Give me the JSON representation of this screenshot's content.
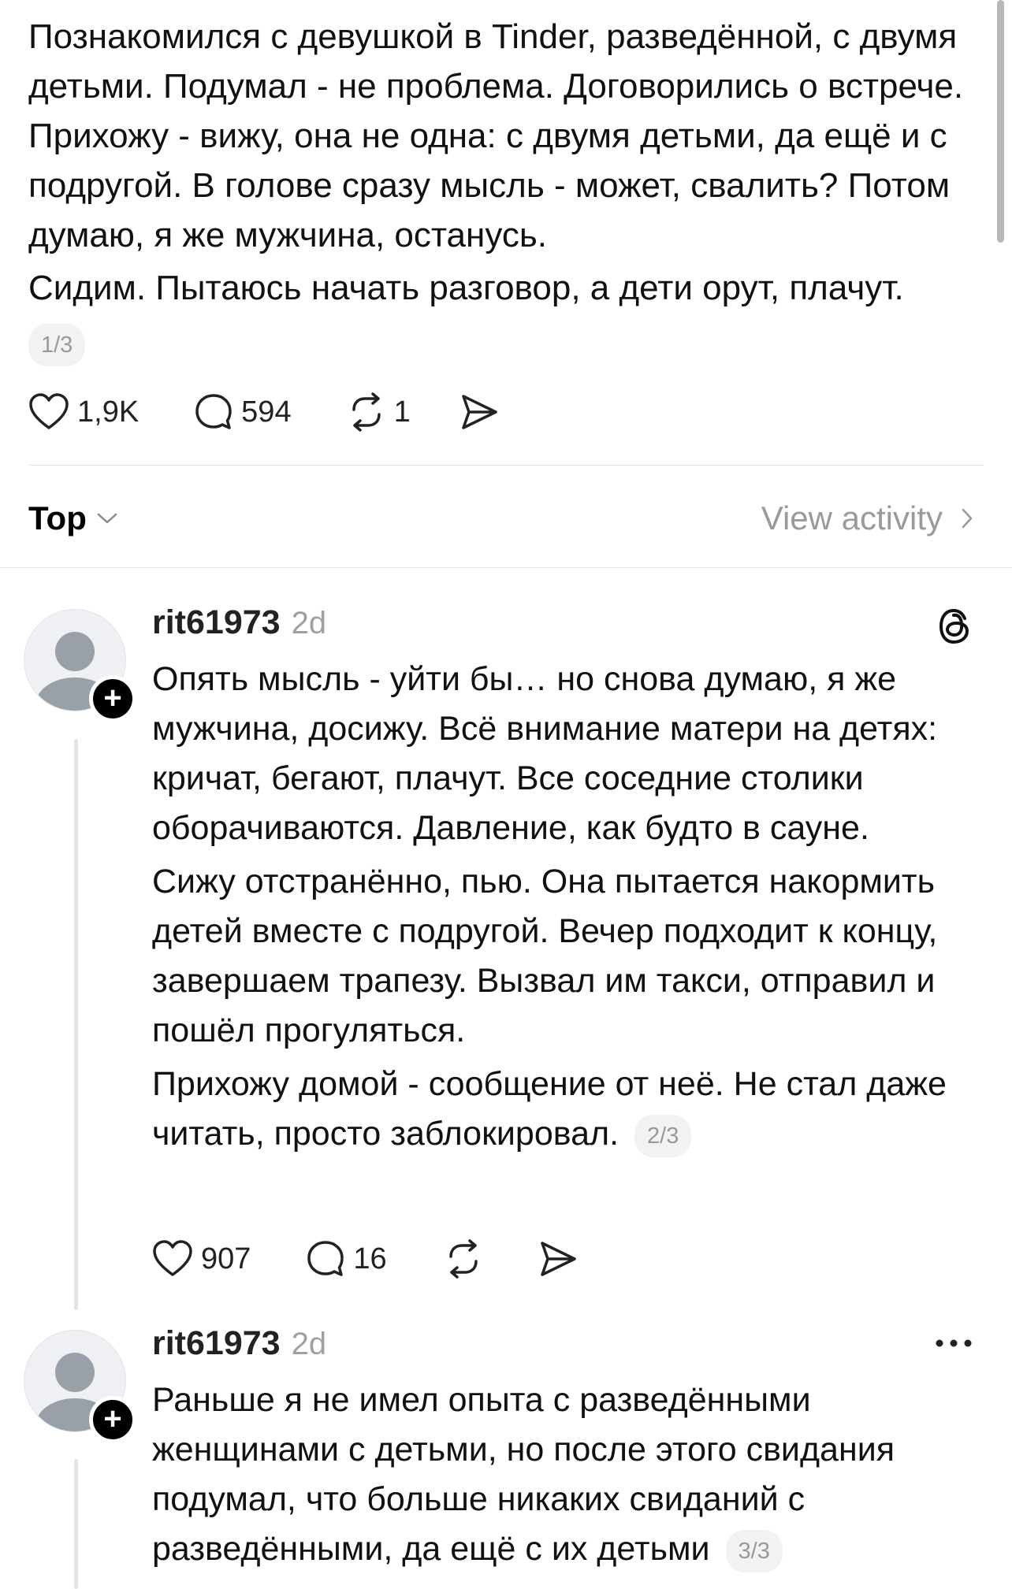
{
  "post": {
    "paragraphs": [
      "Познакомился с девушкой в Tinder, разведённой, с двумя детьми. Подумал - не проблема. Договорились о встрече. Прихожу - вижу, она не одна: с двумя детьми, да ещё и с подругой. В голове сразу мысль - может, свалить? Потом думаю, я же мужчина, останусь.",
      "Сидим. Пытаюсь начать разговор, а дети орут, плачут."
    ],
    "page": "1/3",
    "likes": "1,9K",
    "comments": "594",
    "reposts": "1"
  },
  "sort": {
    "label": "Top",
    "view_activity": "View activity"
  },
  "replies": [
    {
      "username": "rit61973",
      "time": "2d",
      "paragraphs": [
        "Опять мысль - уйти бы… но снова думаю, я же мужчина, досижу. Всё внимание матери на детях: кричат, бегают, плачут. Все соседние столики оборачиваются. Давление, как будто в сауне.",
        "Сижу отстранённо, пью. Она пытается накормить детей вместе с подругой. Вечер подходит к концу, завершаем трапезу. Вызвал им такси, отправил и пошёл прогуляться.",
        "Прихожу домой - сообщение от неё. Не стал даже читать, просто заблокировал."
      ],
      "page": "2/3",
      "likes": "907",
      "comments": "16"
    },
    {
      "username": "rit61973",
      "time": "2d",
      "paragraphs": [
        "Раньше я не имел опыта с разведёнными женщинами с детьми, но после этого свидания подумал, что больше никаких свиданий с разведёнными, да ещё с их детьми"
      ],
      "page": "3/3"
    }
  ],
  "icons": {
    "like": "heart-icon",
    "comment": "comment-bubble-icon",
    "repost": "repost-icon",
    "share": "send-icon",
    "threads": "threads-logo-icon",
    "more": "more-dots-icon",
    "follow": "plus-icon",
    "chevron_down": "chevron-down-icon",
    "chevron_right": "chevron-right-icon"
  }
}
